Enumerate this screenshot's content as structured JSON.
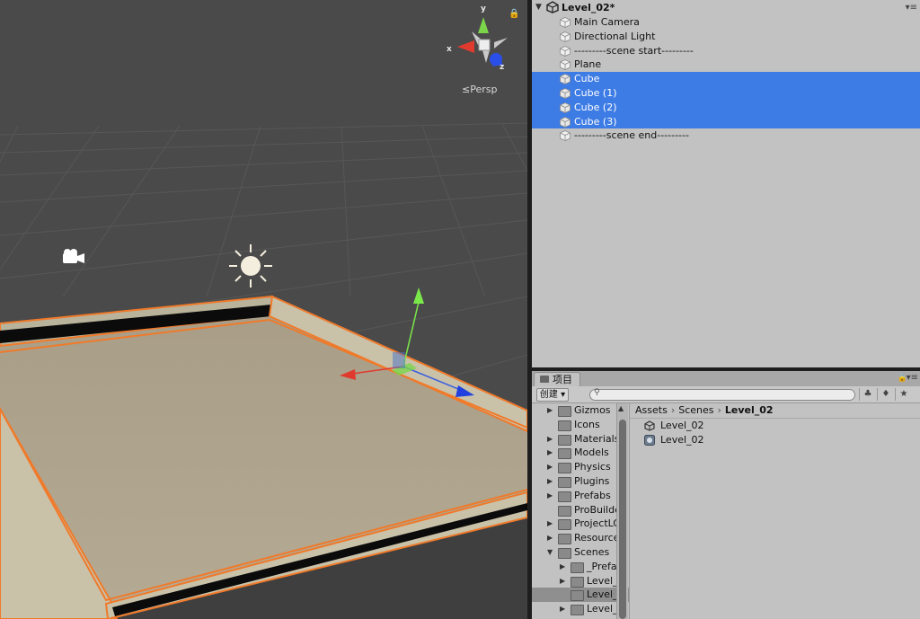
{
  "scene": {
    "axis_x": "x",
    "axis_y": "y",
    "axis_z": "z",
    "projection_label": "≤Persp",
    "lock_icon": "lock-icon"
  },
  "hierarchy": {
    "scene_name": "Level_02*",
    "items": [
      {
        "label": "Main Camera",
        "selected": false
      },
      {
        "label": "Directional Light",
        "selected": false
      },
      {
        "label": "---------scene start---------",
        "selected": false
      },
      {
        "label": "Plane",
        "selected": false
      },
      {
        "label": "Cube",
        "selected": true
      },
      {
        "label": "Cube (1)",
        "selected": true
      },
      {
        "label": "Cube (2)",
        "selected": true
      },
      {
        "label": "Cube (3)",
        "selected": true
      },
      {
        "label": "---------scene end---------",
        "selected": false
      }
    ],
    "selection_color": "#3e7ce5"
  },
  "project": {
    "tab_label": "项目",
    "create_label": "创建 ▾",
    "search_placeholder": "",
    "folders": [
      {
        "label": "Gizmos",
        "expandable": true,
        "indent": 0
      },
      {
        "label": "Icons",
        "expandable": false,
        "indent": 0
      },
      {
        "label": "Materials",
        "expandable": true,
        "indent": 0
      },
      {
        "label": "Models",
        "expandable": true,
        "indent": 0
      },
      {
        "label": "Physics",
        "expandable": true,
        "indent": 0
      },
      {
        "label": "Plugins",
        "expandable": true,
        "indent": 0
      },
      {
        "label": "Prefabs",
        "expandable": true,
        "indent": 0
      },
      {
        "label": "ProBuilder",
        "expandable": false,
        "indent": 0
      },
      {
        "label": "ProjectLO",
        "expandable": true,
        "indent": 0
      },
      {
        "label": "Resources",
        "expandable": true,
        "indent": 0
      },
      {
        "label": "Scenes",
        "expandable": true,
        "expanded": true,
        "indent": 0
      },
      {
        "label": "_Prefa",
        "expandable": true,
        "indent": 1
      },
      {
        "label": "Level_",
        "expandable": true,
        "indent": 1
      },
      {
        "label": "Level_",
        "expandable": false,
        "indent": 1,
        "selected": true
      },
      {
        "label": "Level_",
        "expandable": true,
        "indent": 1
      }
    ],
    "breadcrumb": [
      "Assets",
      "Scenes",
      "Level_02"
    ],
    "assets": [
      {
        "label": "Level_02",
        "icon": "unity-scene-icon"
      },
      {
        "label": "Level_02",
        "icon": "lighting-data-icon"
      }
    ]
  }
}
